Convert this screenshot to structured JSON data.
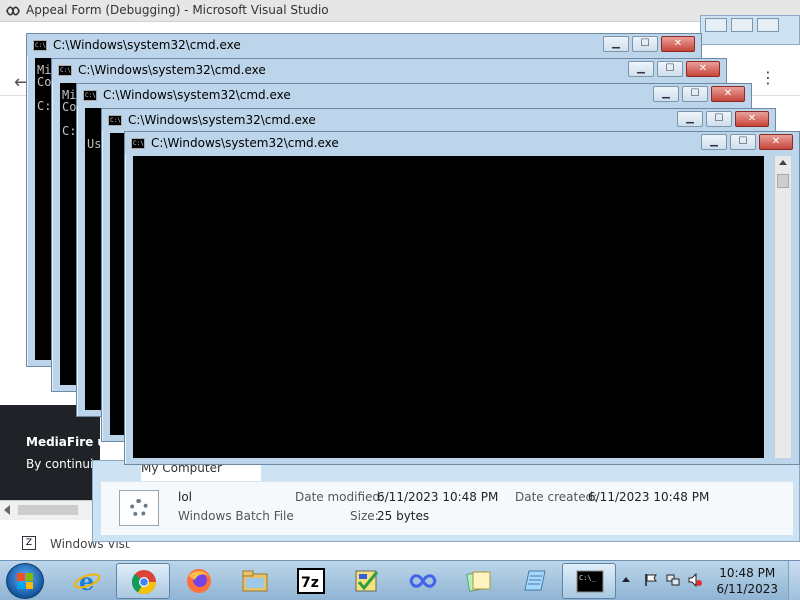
{
  "vs": {
    "title": "Appeal Form (Debugging) - Microsoft Visual Studio"
  },
  "browser": {
    "banner_line1": "MediaFire u",
    "banner_line2": "By continui",
    "windows_vista_label": "Windows Vist"
  },
  "explorer": {
    "location": "My Computer",
    "file": {
      "name": "lol",
      "type": "Windows Batch File",
      "modified_label": "Date modified:",
      "modified_value": "6/11/2023 10:48 PM",
      "created_label": "Date created:",
      "created_value": "6/11/2023 10:48 PM",
      "size_label": "Size:",
      "size_value": "25 bytes"
    }
  },
  "cmd_windows": [
    {
      "title": "C:\\Windows\\system32\\cmd.exe",
      "text": "Mi\nCo\n\nC:"
    },
    {
      "title": "C:\\Windows\\system32\\cmd.exe",
      "text": "Mi\nCo\n\nC:"
    },
    {
      "title": "C:\\Windows\\system32\\cmd.exe",
      "text": "\n\nUs"
    },
    {
      "title": "C:\\Windows\\system32\\cmd.exe",
      "text": ""
    },
    {
      "title": "C:\\Windows\\system32\\cmd.exe",
      "text": ""
    }
  ],
  "cmd_icon_text": "C:\\",
  "window_buttons": {
    "minimize": "▁",
    "maximize": "☐",
    "close": "✕"
  },
  "taskbar": {
    "apps": [
      "chrome",
      "firefox",
      "explorer",
      "7zip",
      "visual-studio",
      "infinity",
      "sticky-notes",
      "notepad",
      "cmd"
    ],
    "time": "10:48 PM",
    "date": "6/11/2023"
  },
  "colors": {
    "window_frame": "#bcd5ea",
    "close_button": "#c7453b",
    "console_bg": "#000000",
    "taskbar": "#8fb4d3"
  }
}
